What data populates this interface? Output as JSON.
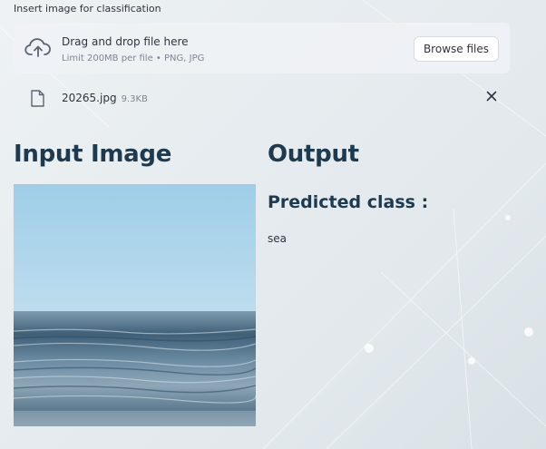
{
  "uploader": {
    "label": "Insert image for classification",
    "drop_title": "Drag and drop file here",
    "limit_text": "Limit 200MB per file • PNG, JPG",
    "browse_label": "Browse files",
    "icon": "cloud-upload-icon"
  },
  "uploaded_file": {
    "name": "20265.jpg",
    "size": "9.3KB",
    "icon": "file-icon",
    "remove_icon": "close-icon"
  },
  "input_column": {
    "heading": "Input Image"
  },
  "output_column": {
    "heading": "Output",
    "predicted_label": "Predicted class :",
    "predicted_value": "sea"
  },
  "colors": {
    "heading": "#1e3a4f",
    "text": "#31333f",
    "muted": "#808495",
    "dropzone_bg": "#f0f2f6"
  }
}
